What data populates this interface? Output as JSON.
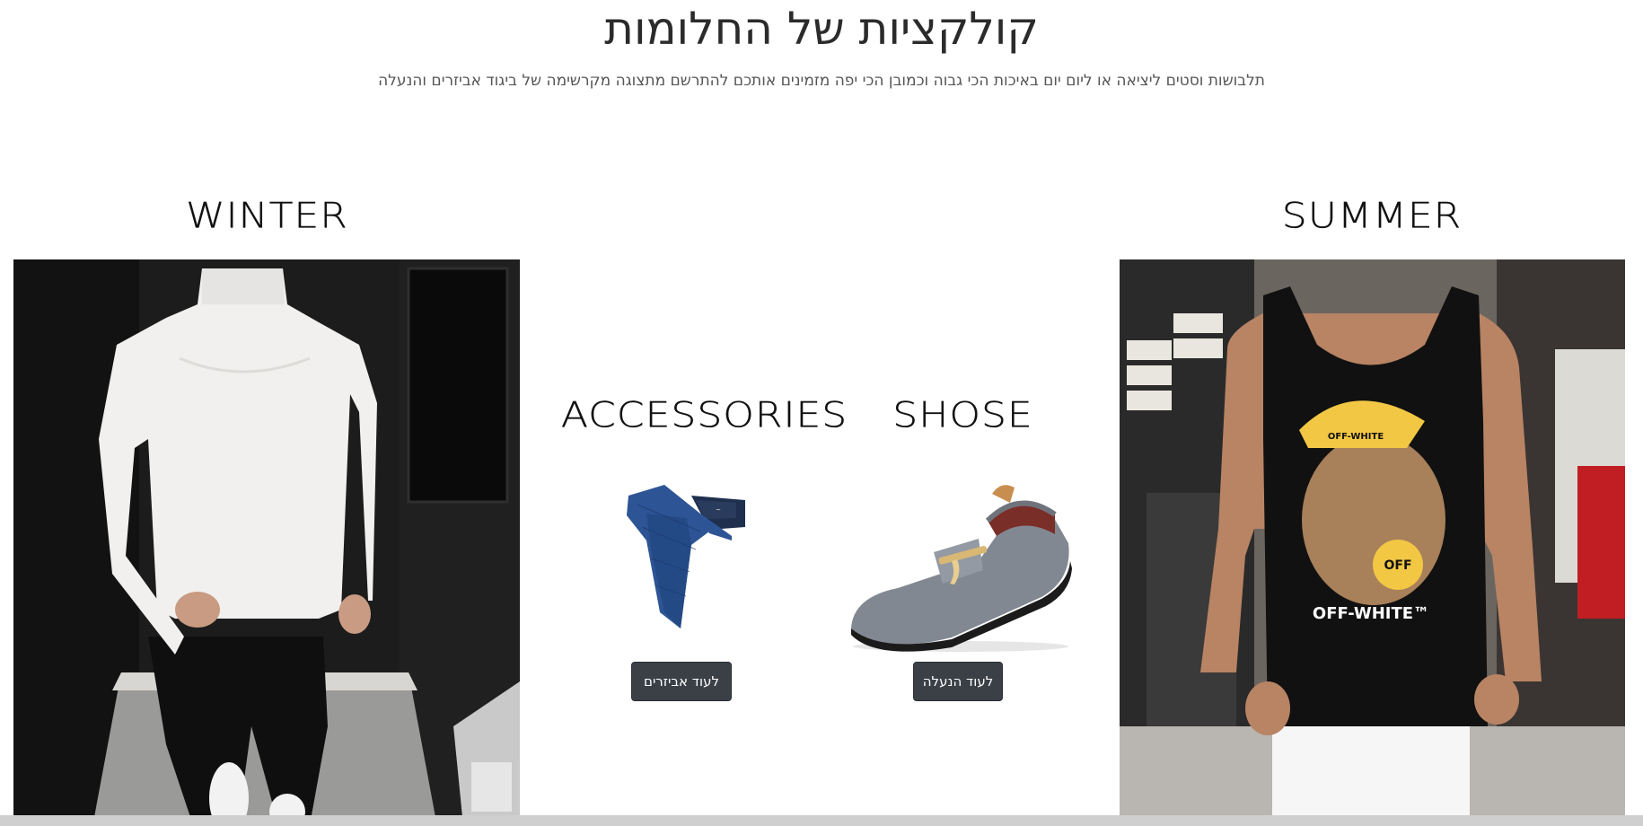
{
  "header": {
    "title": "קולקציות של החלומות",
    "subtitle": "תלבושות וסטים ליציאה או ליום יום באיכות הכי גבוה וכמובן הכי יפה מזמינים אותכם להתרשם מתצוגה מקרשימה של ביגוד אביזרים והנעלה"
  },
  "collections": {
    "winter": {
      "heading": "WINTER"
    },
    "summer": {
      "heading": "SUMMER"
    },
    "accessories": {
      "heading": "ACCESSORIES",
      "button_label": "לעוד אביזרים"
    },
    "shoes": {
      "heading": "SHOSE",
      "button_label": "לעוד הנעלה"
    }
  },
  "summer_shirt_print": {
    "logo_text": "OFF-WHITE™",
    "cap_text": "OFF-WHITE",
    "badge_text": "OFF"
  },
  "colors": {
    "button_bg": "#3b3f46",
    "title_text": "#2b2b2b",
    "subtitle_text": "#555555"
  }
}
